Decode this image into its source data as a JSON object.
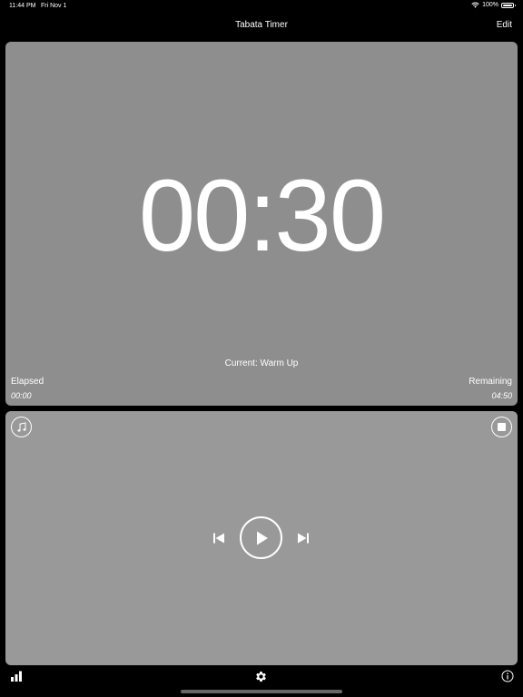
{
  "status_bar": {
    "time": "11:44 PM",
    "date": "Fri Nov 1",
    "battery": "100%",
    "battery_level": 1.0
  },
  "nav": {
    "title": "Tabata Timer",
    "edit_label": "Edit"
  },
  "timer": {
    "display": "00:30",
    "current_label": "Current: Warm Up",
    "elapsed_label": "Elapsed",
    "elapsed_value": "00:00",
    "remaining_label": "Remaining",
    "remaining_value": "04:50"
  },
  "controls": {
    "music_icon": "music-note-icon",
    "stop_icon": "stop-icon",
    "previous_icon": "skip-previous-icon",
    "play_icon": "play-icon",
    "next_icon": "skip-next-icon"
  },
  "tab_bar": {
    "stats_icon": "bar-chart-icon",
    "settings_icon": "gear-icon",
    "info_icon": "info-icon"
  },
  "colors": {
    "background": "#000000",
    "timer_panel": "#8e8e8e",
    "control_panel": "#999999",
    "foreground": "#ffffff"
  }
}
